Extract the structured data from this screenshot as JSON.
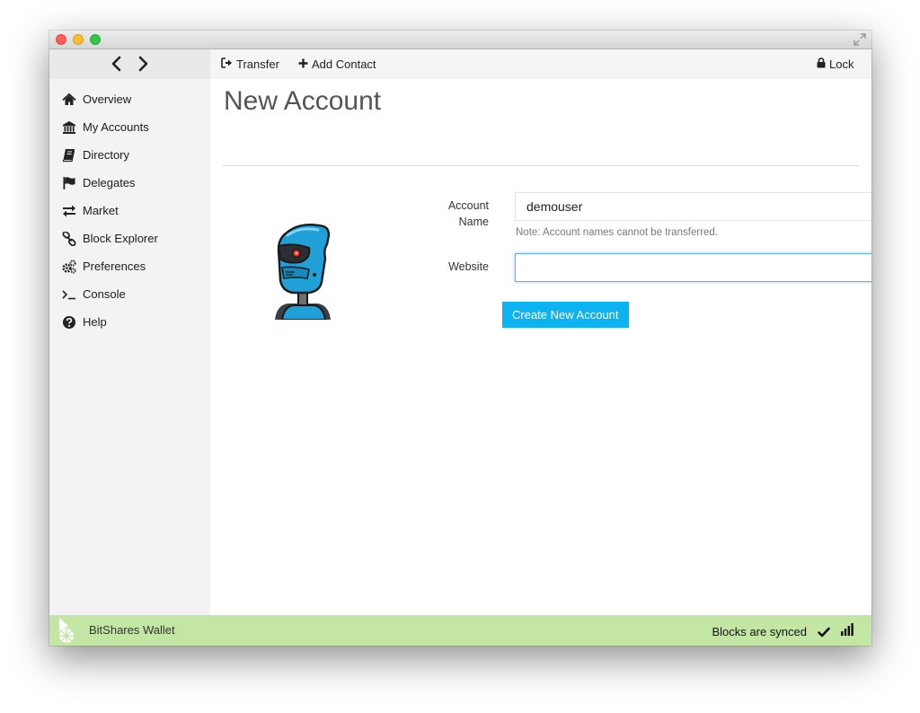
{
  "toolbar": {
    "transfer_label": "Transfer",
    "add_contact_label": "Add Contact",
    "lock_label": "Lock",
    "back_icon": "chevron-left-icon",
    "forward_icon": "chevron-right-icon"
  },
  "sidebar": {
    "items": [
      {
        "label": "Overview",
        "icon": "home-icon"
      },
      {
        "label": "My Accounts",
        "icon": "bank-icon"
      },
      {
        "label": "Directory",
        "icon": "book-icon"
      },
      {
        "label": "Delegates",
        "icon": "flag-icon"
      },
      {
        "label": "Market",
        "icon": "exchange-icon"
      },
      {
        "label": "Block Explorer",
        "icon": "link-icon"
      },
      {
        "label": "Preferences",
        "icon": "gears-icon"
      },
      {
        "label": "Console",
        "icon": "terminal-icon"
      },
      {
        "label": "Help",
        "icon": "question-icon"
      }
    ]
  },
  "main": {
    "title": "New Account",
    "form": {
      "account_name_label": "Account Name",
      "account_name_value": "demouser",
      "account_name_note": "Note: Account names cannot be transferred.",
      "website_label": "Website",
      "website_value": "",
      "submit_label": "Create New Account"
    }
  },
  "status": {
    "app_name": "BitShares Wallet",
    "sync_text": "Blocks are synced",
    "sync_icon": "checkmark-icon",
    "signal_icon": "signal-bars-icon"
  },
  "colors": {
    "accent": "#0bb3f0",
    "statusbar": "#c3e6a5",
    "sidebar": "#f3f3f3"
  }
}
